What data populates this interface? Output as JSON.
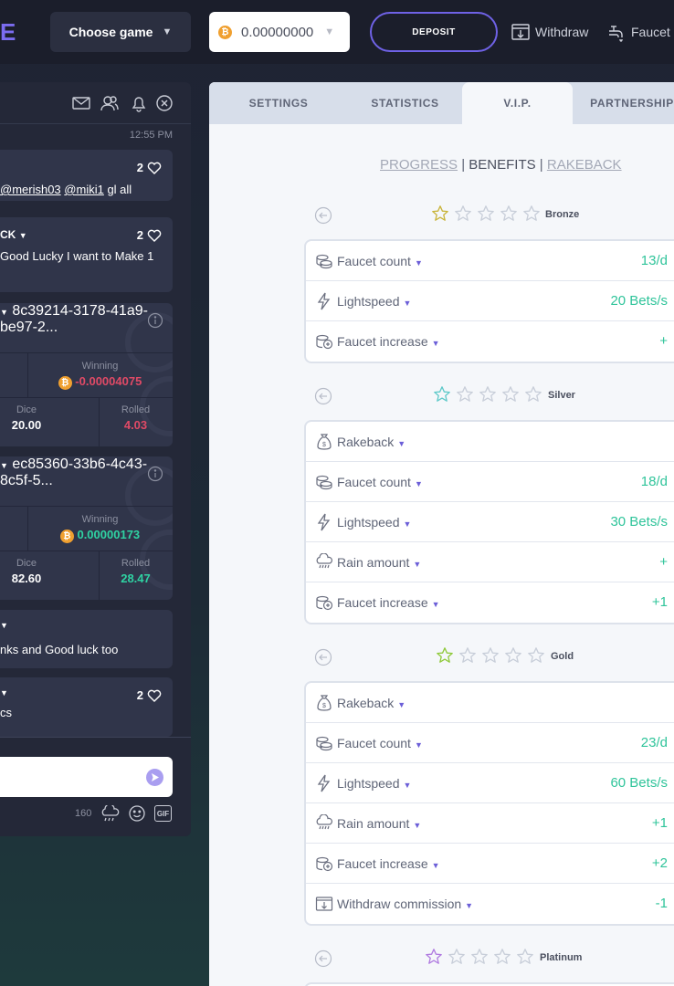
{
  "header": {
    "logo": "E",
    "choose_game": "Choose game",
    "balance": "0.00000000",
    "deposit": "DEPOSIT",
    "withdraw": "Withdraw",
    "faucet": "Faucet"
  },
  "chat": {
    "time": "12:55 PM",
    "messages": [
      {
        "likes": "2",
        "text_a": "@merish03",
        "text_b": "@miki1",
        "text_c": " gl all"
      },
      {
        "name": "CK",
        "likes": "2",
        "line1": "Good Lucky I want to Make 1"
      },
      {
        "hash": "8c39214-3178-41a9-be97-2...",
        "winning_label": "Winning",
        "winning": "-0.00004075",
        "dice_label": "Dice",
        "dice": "20.00",
        "rolled_label": "Rolled",
        "rolled": "4.03"
      },
      {
        "hash": "ec85360-33b6-4c43-8c5f-5...",
        "winning_label": "Winning",
        "winning": "0.00000173",
        "dice_label": "Dice",
        "dice": "82.60",
        "rolled_label": "Rolled",
        "rolled": "28.47"
      },
      {
        "text": "nks and Good luck too"
      },
      {
        "likes": "2",
        "text": "cs"
      }
    ],
    "char_count": "160",
    "gif": "GIF"
  },
  "tabs": [
    "SETTINGS",
    "STATISTICS",
    "V.I.P.",
    "PARTNERSHIP"
  ],
  "subnav": {
    "progress": "PROGRESS",
    "sep1": " | ",
    "benefits": "BENEFITS",
    "sep2": " | ",
    "rakeback": "RAKEBACK"
  },
  "tiers": [
    {
      "name": "Bronze",
      "star_color": "#c9b43a",
      "rows": [
        {
          "icon": "coins-icon",
          "label": "Faucet count",
          "value": "13/d"
        },
        {
          "icon": "lightning-icon",
          "label": "Lightspeed",
          "value": "20 Bets/s"
        },
        {
          "icon": "coins-plus-icon",
          "label": "Faucet increase",
          "value": "+"
        }
      ]
    },
    {
      "name": "Silver",
      "star_color": "#5ec9c9",
      "rows": [
        {
          "icon": "money-bag-icon",
          "label": "Rakeback",
          "value": ""
        },
        {
          "icon": "coins-icon",
          "label": "Faucet count",
          "value": "18/d"
        },
        {
          "icon": "lightning-icon",
          "label": "Lightspeed",
          "value": "30 Bets/s"
        },
        {
          "icon": "rain-icon",
          "label": "Rain amount",
          "value": "+"
        },
        {
          "icon": "coins-plus-icon",
          "label": "Faucet increase",
          "value": "+1"
        }
      ]
    },
    {
      "name": "Gold",
      "star_color": "#8fc93a",
      "rows": [
        {
          "icon": "money-bag-icon",
          "label": "Rakeback",
          "value": ""
        },
        {
          "icon": "coins-icon",
          "label": "Faucet count",
          "value": "23/d"
        },
        {
          "icon": "lightning-icon",
          "label": "Lightspeed",
          "value": "60 Bets/s"
        },
        {
          "icon": "rain-icon",
          "label": "Rain amount",
          "value": "+1"
        },
        {
          "icon": "coins-plus-icon",
          "label": "Faucet increase",
          "value": "+2"
        },
        {
          "icon": "withdraw-icon",
          "label": "Withdraw commission",
          "value": "-1"
        }
      ]
    },
    {
      "name": "Platinum",
      "star_color": "#b07be0",
      "rows": []
    }
  ]
}
